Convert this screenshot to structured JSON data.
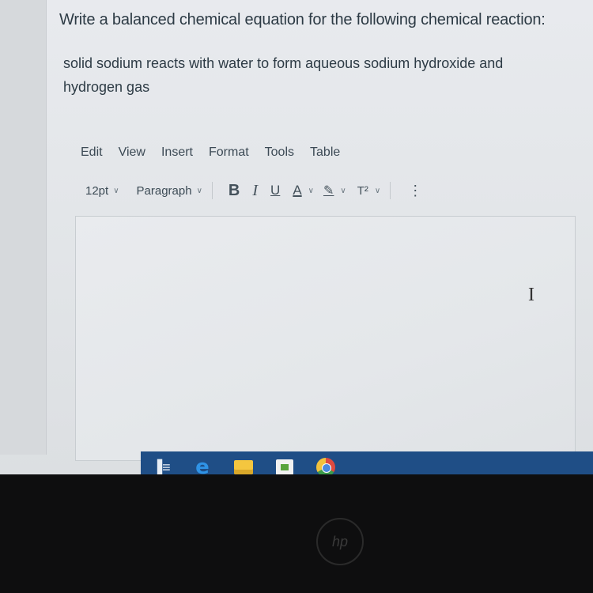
{
  "question": {
    "title": "Write a balanced chemical equation for the following chemical reaction:",
    "prompt": "solid sodium reacts with water to form aqueous sodium hydroxide and hydrogen gas"
  },
  "menubar": {
    "items": [
      "Edit",
      "View",
      "Insert",
      "Format",
      "Tools",
      "Table"
    ]
  },
  "toolbar": {
    "font_size": "12pt",
    "block_format": "Paragraph",
    "bold": "B",
    "italic": "I",
    "underline": "U",
    "text_color": "A",
    "highlight": "✎",
    "superscript": "T²",
    "more": "⋮"
  },
  "editor": {
    "cursor_glyph": "I"
  },
  "taskbar": {
    "icons": [
      "task-view-icon",
      "edge-icon",
      "file-explorer-icon",
      "store-icon",
      "chrome-icon"
    ]
  },
  "bezel": {
    "logo_text": "hp"
  },
  "colors": {
    "text_primary": "#2d3b45",
    "taskbar_blue": "#1f4e86"
  }
}
